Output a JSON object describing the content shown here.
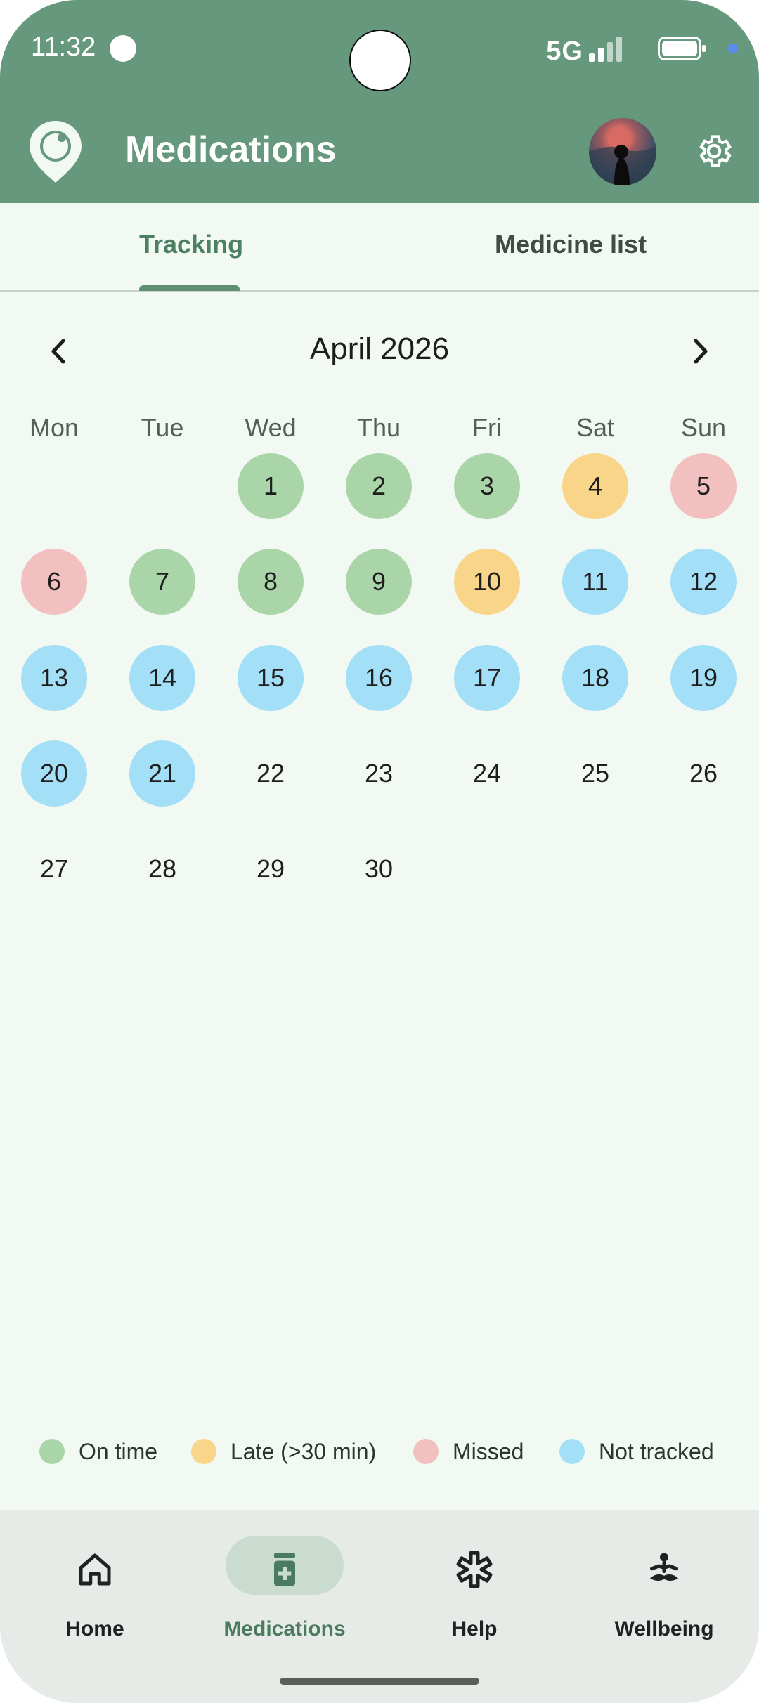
{
  "status_bar": {
    "time": "11:32",
    "network": "5G"
  },
  "app_bar": {
    "title": "Medications",
    "logo_icon": "location-pin-icon",
    "avatar_icon": "avatar",
    "settings_icon": "gear-icon"
  },
  "tabs": [
    {
      "label": "Tracking",
      "active": true
    },
    {
      "label": "Medicine list",
      "active": false
    }
  ],
  "calendar": {
    "month_title": "April 2026",
    "weekdays": [
      "Mon",
      "Tue",
      "Wed",
      "Thu",
      "Fri",
      "Sat",
      "Sun"
    ],
    "first_weekday_index": 2,
    "days": [
      {
        "day": "1",
        "status": "on_time"
      },
      {
        "day": "2",
        "status": "on_time"
      },
      {
        "day": "3",
        "status": "on_time"
      },
      {
        "day": "4",
        "status": "late"
      },
      {
        "day": "5",
        "status": "missed"
      },
      {
        "day": "6",
        "status": "missed"
      },
      {
        "day": "7",
        "status": "on_time"
      },
      {
        "day": "8",
        "status": "on_time"
      },
      {
        "day": "9",
        "status": "on_time"
      },
      {
        "day": "10",
        "status": "late"
      },
      {
        "day": "11",
        "status": "not_tracked"
      },
      {
        "day": "12",
        "status": "not_tracked"
      },
      {
        "day": "13",
        "status": "not_tracked"
      },
      {
        "day": "14",
        "status": "not_tracked"
      },
      {
        "day": "15",
        "status": "not_tracked"
      },
      {
        "day": "16",
        "status": "not_tracked"
      },
      {
        "day": "17",
        "status": "not_tracked"
      },
      {
        "day": "18",
        "status": "not_tracked"
      },
      {
        "day": "19",
        "status": "not_tracked"
      },
      {
        "day": "20",
        "status": "not_tracked"
      },
      {
        "day": "21",
        "status": "not_tracked"
      },
      {
        "day": "22",
        "status": "none"
      },
      {
        "day": "23",
        "status": "none"
      },
      {
        "day": "24",
        "status": "none"
      },
      {
        "day": "25",
        "status": "none"
      },
      {
        "day": "26",
        "status": "none"
      },
      {
        "day": "27",
        "status": "none"
      },
      {
        "day": "28",
        "status": "none"
      },
      {
        "day": "29",
        "status": "none"
      },
      {
        "day": "30",
        "status": "none"
      }
    ]
  },
  "legend": [
    {
      "label": "On time",
      "color": "#aad5a9"
    },
    {
      "label": "Late (>30 min)",
      "color": "#f8d589"
    },
    {
      "label": "Missed",
      "color": "#f1c0bf"
    },
    {
      "label": "Not tracked",
      "color": "#a3dff6"
    }
  ],
  "colors": {
    "header_green": "#66987d",
    "on_time": "#aad5a9",
    "late": "#f8d589",
    "missed": "#f1c0bf",
    "not_tracked": "#a3dff6"
  },
  "bottom_nav": [
    {
      "label": "Home",
      "icon": "home-icon",
      "active": false
    },
    {
      "label": "Medications",
      "icon": "medicine-bottle-icon",
      "active": true
    },
    {
      "label": "Help",
      "icon": "asterisk-icon",
      "active": false
    },
    {
      "label": "Wellbeing",
      "icon": "meditation-icon",
      "active": false
    }
  ]
}
